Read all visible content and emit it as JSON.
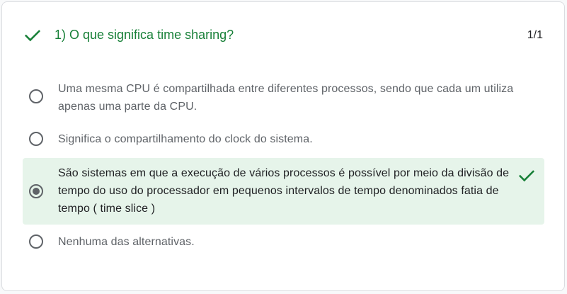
{
  "question": {
    "title": "1) O que significa time sharing?",
    "score": "1/1",
    "status_icon": "check-icon",
    "accent_color": "#188038"
  },
  "options": [
    {
      "text": "Uma mesma CPU é compartilhada entre diferentes processos, sendo que cada um utiliza apenas uma parte da CPU.",
      "selected": false,
      "correct": false
    },
    {
      "text": "Significa o compartilhamento do clock do sistema.",
      "selected": false,
      "correct": false
    },
    {
      "text": "São sistemas em que a execução de vários processos é possível por meio da divisão de tempo do uso do processador em pequenos intervalos de tempo denominados fatia de tempo ( time slice )",
      "selected": true,
      "correct": true,
      "highlight_color": "#e6f4ea"
    },
    {
      "text": "Nenhuma das alternativas.",
      "selected": false,
      "correct": false
    }
  ]
}
